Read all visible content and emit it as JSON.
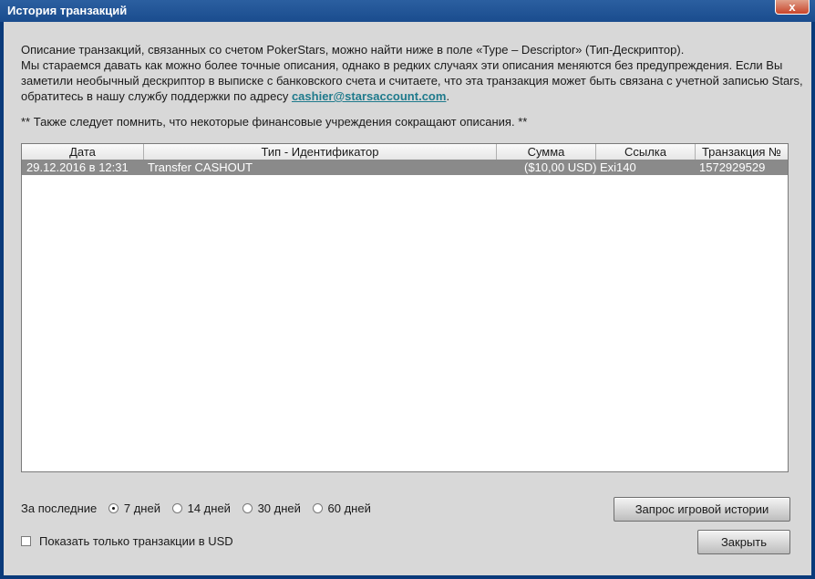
{
  "window": {
    "title": "История транзакций",
    "close_label": "x"
  },
  "description": {
    "line1": "Описание транзакций, связанных со счетом PokerStars, можно найти ниже в поле «Type – Descriptor» (Тип-Дескриптор).",
    "line2_pre": "Мы стараемся давать как можно более точные описания, однако в редких случаях эти описания меняются без предупреждения. Если Вы заметили необычный дескриптор в выписке с банковского счета и считаете, что эта транзакция может быть связана с учетной записью Stars, обратитесь в нашу службу поддержки по адресу ",
    "email": "cashier@starsaccount.com",
    "line2_post": ".",
    "note": "** Также следует помнить, что некоторые финансовые учреждения сокращают описания. **"
  },
  "table": {
    "columns": [
      "Дата",
      "Тип - Идентификатор",
      "Сумма",
      "Ссылка",
      "Транзакция №"
    ],
    "rows": [
      {
        "date": "29.12.2016 в 12:31",
        "type": "Transfer CASHOUT",
        "amount": "($10,00 USD)",
        "ref": "Exi140",
        "txn": "1572929529"
      }
    ]
  },
  "filter": {
    "label": "За последние",
    "options": [
      "7 дней",
      "14 дней",
      "30 дней",
      "60 дней"
    ],
    "selected": "7 дней"
  },
  "usd_only": {
    "label": "Показать только транзакции в USD",
    "checked": false
  },
  "buttons": {
    "history": "Запрос игровой истории",
    "close": "Закрыть"
  }
}
